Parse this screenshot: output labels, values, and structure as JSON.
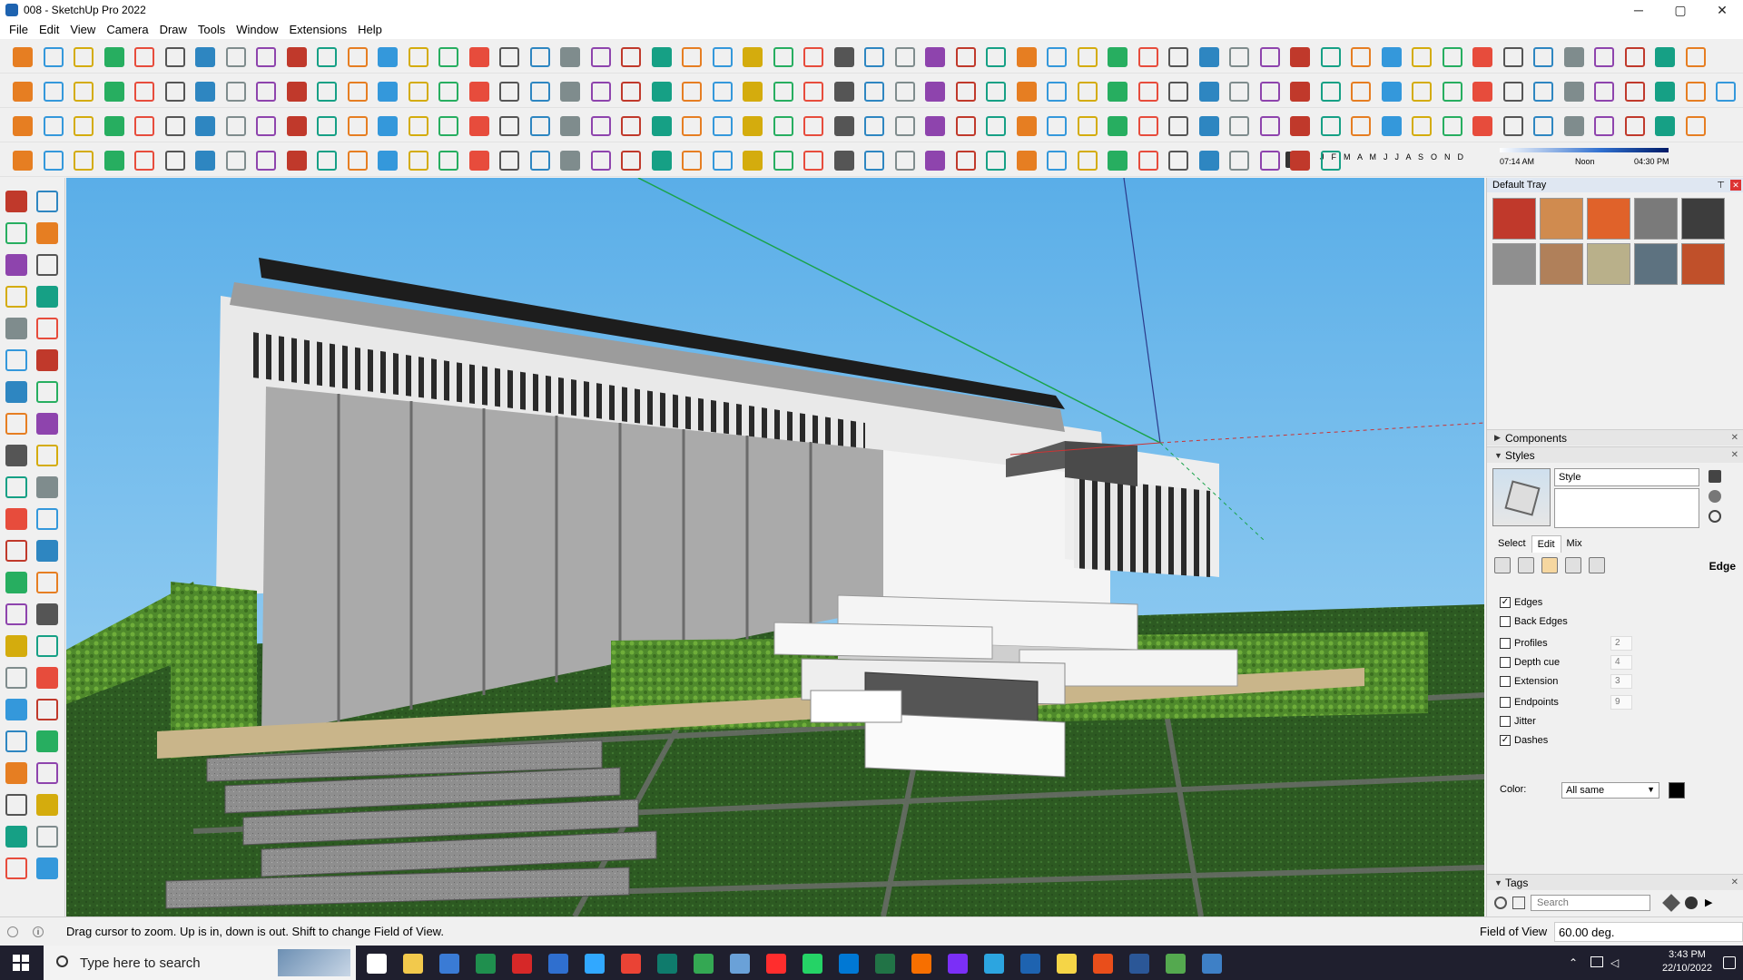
{
  "window": {
    "title": "008 - SketchUp Pro 2022",
    "minimize": "─",
    "maximize": "▢",
    "close": "✕"
  },
  "menu": [
    "File",
    "Edit",
    "View",
    "Camera",
    "Draw",
    "Tools",
    "Window",
    "Extensions",
    "Help"
  ],
  "shadow_bar": {
    "months": "J  F  M  A  M  J  J  A  S  O  N  D",
    "time_start": "07:14 AM",
    "time_mid": "Noon",
    "time_end": "04:30 PM"
  },
  "tray": {
    "title": "Default Tray",
    "swatch_colors": [
      "#c0392b",
      "#d08b4f",
      "#e0622a",
      "#7a7a7a",
      "#3d3d3d",
      "#8f8f8f",
      "#b0805a",
      "#b9b08a",
      "#5d7280",
      "#c0502a"
    ],
    "components_label": "Components",
    "styles_label": "Styles",
    "style_name": "Style",
    "tabs": [
      "Select",
      "Edit",
      "Mix"
    ],
    "edge_heading": "Edge",
    "edge_settings": [
      {
        "label": "Edges",
        "checked": true,
        "value": ""
      },
      {
        "label": "Back Edges",
        "checked": false,
        "value": ""
      },
      {
        "label": "Profiles",
        "checked": false,
        "value": "2"
      },
      {
        "label": "Depth cue",
        "checked": false,
        "value": "4"
      },
      {
        "label": "Extension",
        "checked": false,
        "value": "3"
      },
      {
        "label": "Endpoints",
        "checked": false,
        "value": "9"
      },
      {
        "label": "Jitter",
        "checked": false,
        "value": ""
      },
      {
        "label": "Dashes",
        "checked": true,
        "value": ""
      }
    ],
    "color_label": "Color:",
    "color_option": "All same",
    "edge_color": "#000000",
    "tags_label": "Tags",
    "search_placeholder": "Search"
  },
  "status": {
    "message": "Drag cursor to zoom.  Up is in, down is out. Shift to change Field of View.",
    "measure_label": "Field of View",
    "measure_value": "60.00 deg."
  },
  "taskbar": {
    "search_placeholder": "Type here to search",
    "time": "3:43 PM",
    "date": "22/10/2022"
  }
}
